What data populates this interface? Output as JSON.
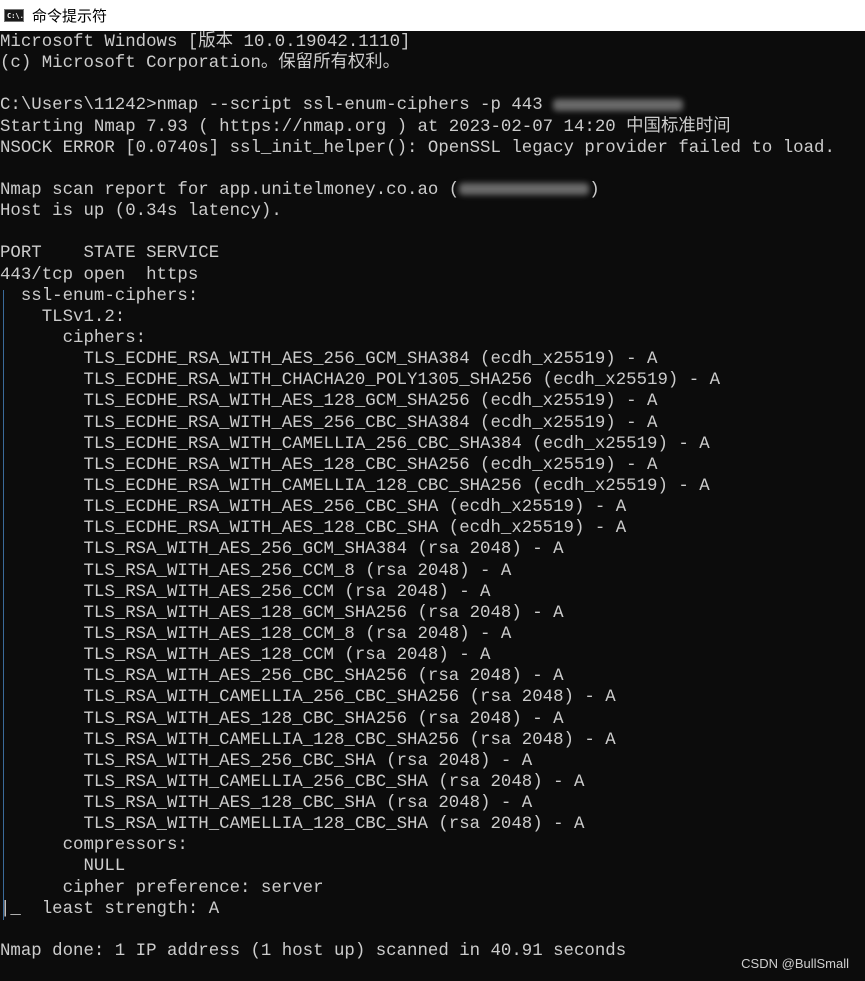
{
  "window": {
    "title": "命令提示符",
    "icon": "cmd-icon",
    "icon_text": "C:\\."
  },
  "colors": {
    "background": "#0c0c0c",
    "text": "#cccccc"
  },
  "console": {
    "lines": [
      "Microsoft Windows [版本 10.0.19042.1110]",
      "(c) Microsoft Corporation。保留所有权利。",
      "",
      "C:\\Users\\11242>nmap --script ssl-enum-ciphers -p 443 ",
      "Starting Nmap 7.93 ( https://nmap.org ) at 2023-02-07 14:20 中国标准时间",
      "NSOCK ERROR [0.0740s] ssl_init_helper(): OpenSSL legacy provider failed to load.",
      "",
      "Nmap scan report for app.unitelmoney.co.ao (",
      "Host is up (0.34s latency).",
      "",
      "PORT    STATE SERVICE",
      "443/tcp open  https",
      "  ssl-enum-ciphers:",
      "    TLSv1.2:",
      "      ciphers:",
      "        TLS_ECDHE_RSA_WITH_AES_256_GCM_SHA384 (ecdh_x25519) - A",
      "        TLS_ECDHE_RSA_WITH_CHACHA20_POLY1305_SHA256 (ecdh_x25519) - A",
      "        TLS_ECDHE_RSA_WITH_AES_128_GCM_SHA256 (ecdh_x25519) - A",
      "        TLS_ECDHE_RSA_WITH_AES_256_CBC_SHA384 (ecdh_x25519) - A",
      "        TLS_ECDHE_RSA_WITH_CAMELLIA_256_CBC_SHA384 (ecdh_x25519) - A",
      "        TLS_ECDHE_RSA_WITH_AES_128_CBC_SHA256 (ecdh_x25519) - A",
      "        TLS_ECDHE_RSA_WITH_CAMELLIA_128_CBC_SHA256 (ecdh_x25519) - A",
      "        TLS_ECDHE_RSA_WITH_AES_256_CBC_SHA (ecdh_x25519) - A",
      "        TLS_ECDHE_RSA_WITH_AES_128_CBC_SHA (ecdh_x25519) - A",
      "        TLS_RSA_WITH_AES_256_GCM_SHA384 (rsa 2048) - A",
      "        TLS_RSA_WITH_AES_256_CCM_8 (rsa 2048) - A",
      "        TLS_RSA_WITH_AES_256_CCM (rsa 2048) - A",
      "        TLS_RSA_WITH_AES_128_GCM_SHA256 (rsa 2048) - A",
      "        TLS_RSA_WITH_AES_128_CCM_8 (rsa 2048) - A",
      "        TLS_RSA_WITH_AES_128_CCM (rsa 2048) - A",
      "        TLS_RSA_WITH_AES_256_CBC_SHA256 (rsa 2048) - A",
      "        TLS_RSA_WITH_CAMELLIA_256_CBC_SHA256 (rsa 2048) - A",
      "        TLS_RSA_WITH_AES_128_CBC_SHA256 (rsa 2048) - A",
      "        TLS_RSA_WITH_CAMELLIA_128_CBC_SHA256 (rsa 2048) - A",
      "        TLS_RSA_WITH_AES_256_CBC_SHA (rsa 2048) - A",
      "        TLS_RSA_WITH_CAMELLIA_256_CBC_SHA (rsa 2048) - A",
      "        TLS_RSA_WITH_AES_128_CBC_SHA (rsa 2048) - A",
      "        TLS_RSA_WITH_CAMELLIA_128_CBC_SHA (rsa 2048) - A",
      "      compressors:",
      "        NULL",
      "      cipher preference: server",
      "|_  least strength: A",
      "",
      "Nmap done: 1 IP address (1 host up) scanned in 40.91 seconds"
    ],
    "redacted_suffix": ")"
  },
  "watermark": "CSDN @BullSmall"
}
